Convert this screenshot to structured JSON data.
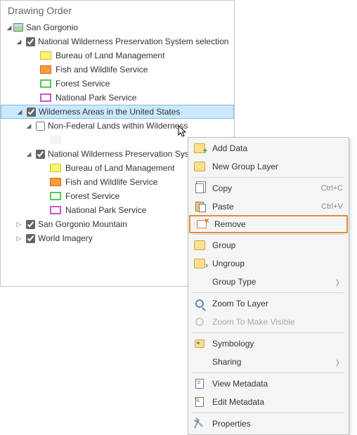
{
  "panel": {
    "title": "Drawing Order"
  },
  "tree": {
    "root": "San Gorgonio",
    "g1": {
      "label": "National Wilderness Preservation System selection",
      "items": [
        {
          "label": "Bureau of Land Management",
          "color": "#fff568",
          "border": "#c9be3c"
        },
        {
          "label": "Fish and Wildlife Service",
          "color": "#ff9a3c",
          "border": "#c96f1f"
        },
        {
          "label": "Forest Service",
          "color": "#ffffff",
          "border": "#57c957"
        },
        {
          "label": "National Park Service",
          "color": "#ffffff",
          "border": "#c957c9"
        }
      ]
    },
    "g2": {
      "label": "Wilderness Areas in the United States"
    },
    "g2a": {
      "label": "Non-Federal Lands within Wilderness",
      "items": [
        {
          "label": "",
          "color": "",
          "border": ""
        }
      ]
    },
    "g2b": {
      "label": "National Wilderness Preservation System",
      "items": [
        {
          "label": "Bureau of Land Management",
          "color": "#fff568",
          "border": "#c9be3c"
        },
        {
          "label": "Fish and Wildlife Service",
          "color": "#ff9a3c",
          "border": "#c96f1f"
        },
        {
          "label": "Forest Service",
          "color": "#ffffff",
          "border": "#57c957"
        },
        {
          "label": "National Park Service",
          "color": "#ffffff",
          "border": "#c957c9"
        }
      ]
    },
    "g3": {
      "label": "San Gorgonio Mountain"
    },
    "g4": {
      "label": "World Imagery"
    }
  },
  "menu": {
    "addData": "Add Data",
    "newGroup": "New Group Layer",
    "copy": "Copy",
    "copyKey": "Ctrl+C",
    "paste": "Paste",
    "pasteKey": "Ctrl+V",
    "remove": "Remove",
    "group": "Group",
    "ungroup": "Ungroup",
    "groupType": "Group Type",
    "zoomLayer": "Zoom To Layer",
    "zoomVisible": "Zoom To Make Visible",
    "symbology": "Symbology",
    "sharing": "Sharing",
    "viewMeta": "View Metadata",
    "editMeta": "Edit Metadata",
    "properties": "Properties"
  }
}
